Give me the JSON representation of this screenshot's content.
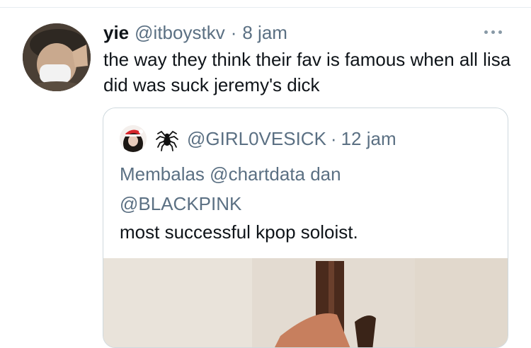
{
  "tweet": {
    "display_name": "yie",
    "handle": "@itboystkv",
    "separator": "·",
    "time": "8 jam",
    "text": "the way they think their fav is famous when all lisa did was suck jeremy's dick",
    "more_icon": "more-horizontal-icon"
  },
  "quote": {
    "handle": "@GIRL0VESICK",
    "separator": "·",
    "time": "12 jam",
    "emoji": "spider",
    "reply_prefix": "Membalas",
    "mention_1": "@chartdata",
    "conjunction": "dan",
    "mention_2": "@BLACKPINK",
    "text": "most successful kpop soloist."
  },
  "colors": {
    "text_primary": "#0f1419",
    "text_secondary": "#5b7083",
    "border": "#cfd9de"
  }
}
